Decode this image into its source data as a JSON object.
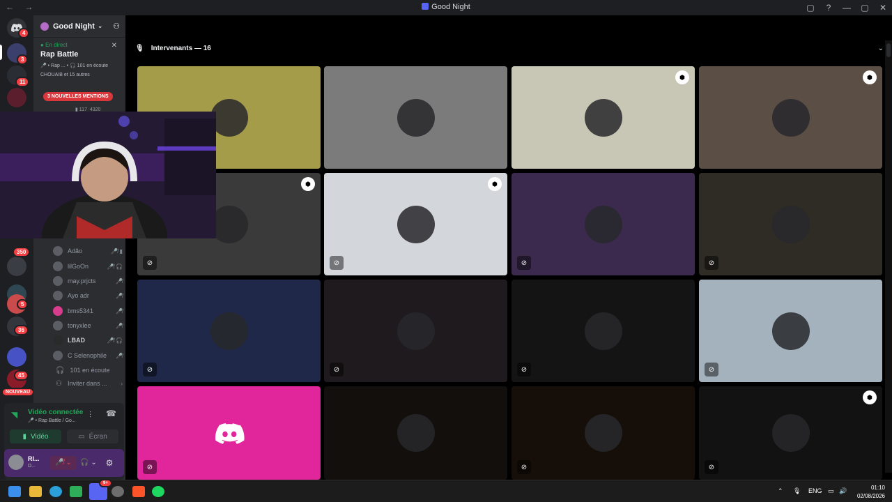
{
  "window": {
    "title": "Good Night",
    "controls": [
      "▢",
      "?",
      "—",
      "▢",
      "✕"
    ]
  },
  "servers": {
    "badges": [
      "4",
      "3",
      "11",
      "350",
      "5",
      "36",
      "45"
    ],
    "new_label": "NOUVEAU"
  },
  "channels": {
    "server_name": "Good Night",
    "live_label": "En direct",
    "stage_name": "Rap Battle",
    "stage_meta": "🎤 • Rap ...  •  🎧 101 en écoute",
    "stage_people": "CHOUAIB et 15 autres",
    "mention_banner": "3 NOUVELLES MENTIONS",
    "counts": [
      "117",
      "4320"
    ],
    "members": [
      {
        "name": "Adão",
        "icons": "🎤̸ ▮"
      },
      {
        "name": "lilGoOn",
        "icons": "🎤̸ 🎧"
      },
      {
        "name": "may.prjcts",
        "icons": "🎤̸"
      },
      {
        "name": "Ayo adr",
        "icons": "🎤̸"
      },
      {
        "name": "bms5341",
        "icons": "🎤̸"
      },
      {
        "name": "tonyxlee",
        "icons": "🎤̸"
      },
      {
        "name": "LBAD",
        "icons": "🎤̸ 🎧"
      },
      {
        "name": "C Selenophile",
        "icons": "🎤̸"
      },
      {
        "name": "101 en écoute",
        "icons": ""
      },
      {
        "name": "Inviter dans ...",
        "icons": "›"
      }
    ]
  },
  "voice": {
    "status": "Vidéo connectée",
    "channel": "🎤 • Rap Battle / Go...",
    "video_label": "Vidéo",
    "screen_label": "Écran",
    "user_name": "RI...",
    "user_sub": "D..."
  },
  "stage": {
    "header": "Intervenants — 16"
  },
  "tiles": [
    {
      "bg": "#a59c4a",
      "mute": false,
      "mod": false
    },
    {
      "bg": "#7b7b7b",
      "mute": false,
      "mod": false
    },
    {
      "bg": "#c8c6b4",
      "mute": false,
      "mod": true
    },
    {
      "bg": "#5a4e45",
      "mute": false,
      "mod": true
    },
    {
      "bg": "#3a3a3a",
      "mute": true,
      "mod": true
    },
    {
      "bg": "#d3d6da",
      "mute": true,
      "mod": true
    },
    {
      "bg": "#3b2a4e",
      "mute": true,
      "mod": false
    },
    {
      "bg": "#2f2b25",
      "mute": true,
      "mod": false
    },
    {
      "bg": "#1f2848",
      "mute": true,
      "mod": false
    },
    {
      "bg": "#1f1a1d",
      "mute": true,
      "mod": false
    },
    {
      "bg": "#141414",
      "mute": true,
      "mod": false
    },
    {
      "bg": "#a4b2be",
      "mute": true,
      "mod": false
    },
    {
      "bg": "#e0269a",
      "mute": true,
      "mod": false
    },
    {
      "bg": "#120f0c",
      "mute": false,
      "mod": false
    },
    {
      "bg": "#160f09",
      "mute": true,
      "mod": false
    },
    {
      "bg": "#121212",
      "mute": true,
      "mod": true
    }
  ],
  "taskbar": {
    "lang": "ENG",
    "time": "01:10",
    "date": "02/08/2026",
    "discord_badge": "9+"
  }
}
